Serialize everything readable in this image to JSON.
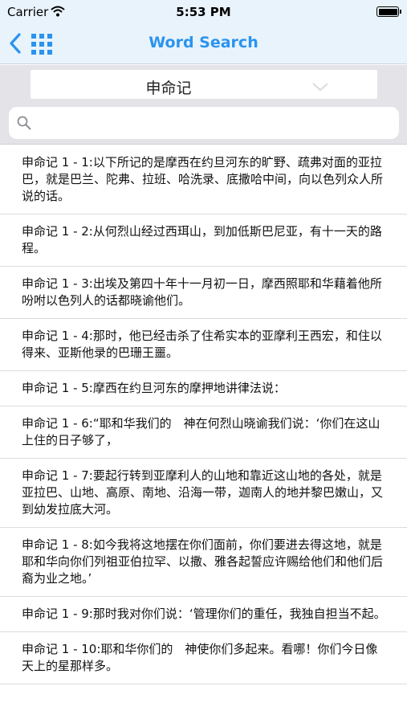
{
  "status": {
    "carrier": "Carrier",
    "time": "5:53 PM"
  },
  "nav": {
    "title": "Word Search",
    "back_icon": "chevron-left-icon",
    "grid_icon": "grid-icon"
  },
  "book": {
    "selected": "申命记"
  },
  "search": {
    "placeholder": "",
    "value": ""
  },
  "colors": {
    "accent": "#2a93f0",
    "nav_bg": "#e9f3fb",
    "toolbar_bg": "#e3e3e8"
  },
  "verses": [
    {
      "text": "申命记 1 - 1:以下所记的是摩西在约旦河东的旷野、疏弗对面的亚拉巴，就是巴兰、陀弗、拉班、哈洗录、底撒哈中间，向以色列众人所说的话。"
    },
    {
      "text": "申命记 1 - 2:从何烈山经过西珥山，到加低斯巴尼亚，有十一天的路程。"
    },
    {
      "text": "申命记 1 - 3:出埃及第四十年十一月初一日，摩西照耶和华藉着他所吩咐以色列人的话都晓谕他们。"
    },
    {
      "text": "申命记 1 - 4:那时，他已经击杀了住希实本的亚摩利王西宏，和住以得来、亚斯他录的巴珊王噩。"
    },
    {
      "text": "申命记 1 - 5:摩西在约旦河东的摩押地讲律法说："
    },
    {
      "text": "申命记 1 - 6:“耶和华我们的　神在何烈山晓谕我们说：‘你们在这山上住的日子够了，"
    },
    {
      "text": "申命记 1 - 7:要起行转到亚摩利人的山地和靠近这山地的各处，就是亚拉巴、山地、高原、南地、沿海一带，迦南人的地并黎巴嫩山，又到幼发拉底大河。"
    },
    {
      "text": "申命记 1 - 8:如今我将这地摆在你们面前，你们要进去得这地，就是耶和华向你们列祖亚伯拉罕、以撒、雅各起誓应许赐给他们和他们后裔为业之地。’"
    },
    {
      "text": "申命记 1 - 9:那时我对你们说：‘管理你们的重任，我独自担当不起。"
    },
    {
      "text": "申命记 1 - 10:耶和华你们的　神使你们多起来。看哪！你们今日像天上的星那样多。"
    }
  ]
}
